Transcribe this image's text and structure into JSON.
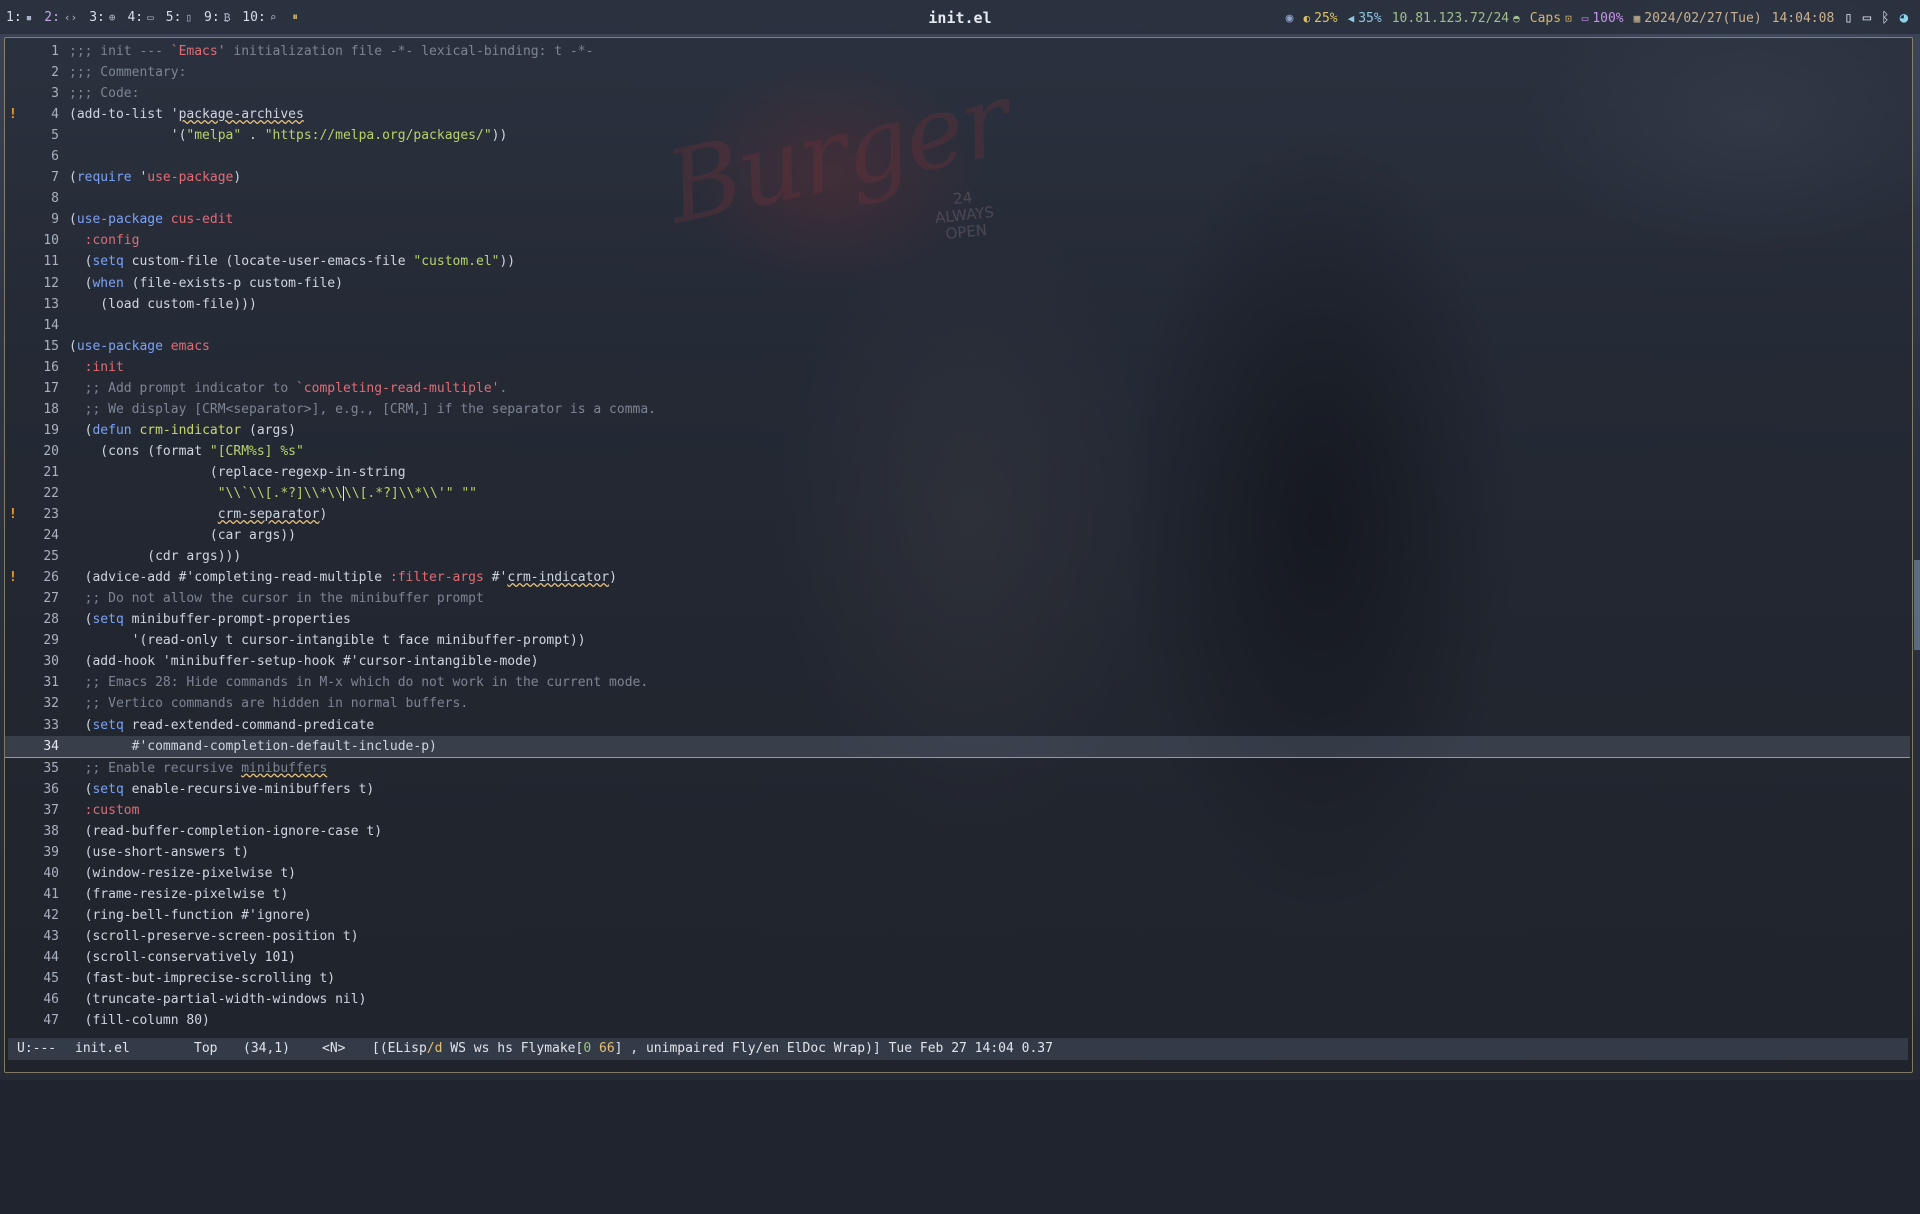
{
  "topbar": {
    "workspaces": [
      {
        "num": "1:",
        "icon": "terminal-icon",
        "glyph": "▪"
      },
      {
        "num": "2:",
        "icon": "code-icon",
        "glyph": "‹›"
      },
      {
        "num": "3:",
        "icon": "globe-icon",
        "glyph": "⊕"
      },
      {
        "num": "4:",
        "icon": "chat-icon",
        "glyph": "▭"
      },
      {
        "num": "5:",
        "icon": "file-icon",
        "glyph": "▯"
      },
      {
        "num": "9:",
        "icon": "bitcoin-icon",
        "glyph": "₿"
      },
      {
        "num": "10:",
        "icon": "search-icon",
        "glyph": "⌕"
      }
    ],
    "active_workspace_index": 1,
    "extra_glyph": "⏸",
    "window_title": "init.el",
    "status": {
      "brightness": "25%",
      "volume": "35%",
      "ip": "10.81.123.72/24",
      "caps": "Caps",
      "battery": "100%",
      "date": "2024/02/27(Tue)",
      "time": "14:04:08"
    }
  },
  "editor": {
    "current_line": 34,
    "lines": [
      {
        "n": "1",
        "fringe": "",
        "segs": [
          {
            "t": ";;; init --- ",
            "c": "c-com"
          },
          {
            "t": "`Emacs'",
            "c": "c-red"
          },
          {
            "t": " initialization file -*- lexical-binding: t -*-",
            "c": "c-com"
          }
        ]
      },
      {
        "n": "2",
        "fringe": "",
        "segs": [
          {
            "t": ";;; Commentary:",
            "c": "c-com"
          }
        ]
      },
      {
        "n": "3",
        "fringe": "",
        "segs": [
          {
            "t": ";;; Code:",
            "c": "c-com"
          }
        ]
      },
      {
        "n": "4",
        "fringe": "!",
        "segs": [
          {
            "t": "(add-to-list '",
            "c": ""
          },
          {
            "t": "package-archives",
            "c": "c-err"
          }
        ]
      },
      {
        "n": "5",
        "fringe": "",
        "segs": [
          {
            "t": "             '(",
            "c": ""
          },
          {
            "t": "\"melpa\"",
            "c": "c-str"
          },
          {
            "t": " . ",
            "c": ""
          },
          {
            "t": "\"https://melpa.org/packages/\"",
            "c": "c-str"
          },
          {
            "t": "))",
            "c": ""
          }
        ]
      },
      {
        "n": "6",
        "fringe": "",
        "segs": []
      },
      {
        "n": "7",
        "fringe": "",
        "segs": [
          {
            "t": "(",
            "c": ""
          },
          {
            "t": "require",
            "c": "c-kw"
          },
          {
            "t": " '",
            "c": ""
          },
          {
            "t": "use-package",
            "c": "c-const"
          },
          {
            "t": ")",
            "c": ""
          }
        ]
      },
      {
        "n": "8",
        "fringe": "",
        "segs": []
      },
      {
        "n": "9",
        "fringe": "",
        "segs": [
          {
            "t": "(",
            "c": ""
          },
          {
            "t": "use-package",
            "c": "c-kw"
          },
          {
            "t": " ",
            "c": ""
          },
          {
            "t": "cus-edit",
            "c": "c-const"
          }
        ]
      },
      {
        "n": "10",
        "fringe": "",
        "segs": [
          {
            "t": "  ",
            "c": ""
          },
          {
            "t": ":config",
            "c": "c-const"
          }
        ]
      },
      {
        "n": "11",
        "fringe": "",
        "segs": [
          {
            "t": "  (",
            "c": ""
          },
          {
            "t": "setq",
            "c": "c-kw"
          },
          {
            "t": " custom-file (locate-user-emacs-file ",
            "c": ""
          },
          {
            "t": "\"custom.el\"",
            "c": "c-str"
          },
          {
            "t": "))",
            "c": ""
          }
        ]
      },
      {
        "n": "12",
        "fringe": "",
        "segs": [
          {
            "t": "  (",
            "c": ""
          },
          {
            "t": "when",
            "c": "c-kw"
          },
          {
            "t": " (file-exists-p custom-file)",
            "c": ""
          }
        ]
      },
      {
        "n": "13",
        "fringe": "",
        "segs": [
          {
            "t": "    (load custom-file)))",
            "c": ""
          }
        ]
      },
      {
        "n": "14",
        "fringe": "",
        "segs": []
      },
      {
        "n": "15",
        "fringe": "",
        "segs": [
          {
            "t": "(",
            "c": ""
          },
          {
            "t": "use-package",
            "c": "c-kw"
          },
          {
            "t": " ",
            "c": ""
          },
          {
            "t": "emacs",
            "c": "c-const"
          }
        ]
      },
      {
        "n": "16",
        "fringe": "",
        "segs": [
          {
            "t": "  ",
            "c": ""
          },
          {
            "t": ":init",
            "c": "c-const"
          }
        ]
      },
      {
        "n": "17",
        "fringe": "",
        "segs": [
          {
            "t": "  ;; Add prompt indicator to ",
            "c": "c-com"
          },
          {
            "t": "`completing-read-multiple'",
            "c": "c-red"
          },
          {
            "t": ".",
            "c": "c-com"
          }
        ]
      },
      {
        "n": "18",
        "fringe": "",
        "segs": [
          {
            "t": "  ;; We display [CRM<separator>], e.g., [CRM,] if the separator is a comma.",
            "c": "c-com"
          }
        ]
      },
      {
        "n": "19",
        "fringe": "",
        "segs": [
          {
            "t": "  (",
            "c": ""
          },
          {
            "t": "defun",
            "c": "c-kw"
          },
          {
            "t": " ",
            "c": ""
          },
          {
            "t": "crm-indicator",
            "c": "c-fn"
          },
          {
            "t": " (args)",
            "c": ""
          }
        ]
      },
      {
        "n": "20",
        "fringe": "",
        "segs": [
          {
            "t": "    (cons (format ",
            "c": ""
          },
          {
            "t": "\"[CRM%s] %s\"",
            "c": "c-str"
          }
        ]
      },
      {
        "n": "21",
        "fringe": "",
        "segs": [
          {
            "t": "                  (replace-regexp-in-string",
            "c": ""
          }
        ]
      },
      {
        "n": "22",
        "fringe": "",
        "segs": [
          {
            "t": "                   ",
            "c": ""
          },
          {
            "t": "\"\\\\`\\\\[.*?]\\\\*\\\\",
            "c": "c-str"
          },
          {
            "t": "|",
            "c": "cursor"
          },
          {
            "t": "\\\\[.*?]\\\\*\\\\'\" \"\"",
            "c": "c-str"
          }
        ]
      },
      {
        "n": "23",
        "fringe": "!",
        "segs": [
          {
            "t": "                   ",
            "c": ""
          },
          {
            "t": "crm-separator",
            "c": "c-err"
          },
          {
            "t": ")",
            "c": ""
          }
        ]
      },
      {
        "n": "24",
        "fringe": "",
        "segs": [
          {
            "t": "                  (car args))",
            "c": ""
          }
        ]
      },
      {
        "n": "25",
        "fringe": "",
        "segs": [
          {
            "t": "          (cdr args)))",
            "c": ""
          }
        ]
      },
      {
        "n": "26",
        "fringe": "!",
        "segs": [
          {
            "t": "  (advice-add #'completing-read-multiple ",
            "c": ""
          },
          {
            "t": ":filter-args",
            "c": "c-const"
          },
          {
            "t": " #'",
            "c": ""
          },
          {
            "t": "crm-indicator",
            "c": "c-err"
          },
          {
            "t": ")",
            "c": ""
          }
        ]
      },
      {
        "n": "27",
        "fringe": "",
        "segs": [
          {
            "t": "  ;; Do not allow the cursor in the minibuffer prompt",
            "c": "c-com"
          }
        ]
      },
      {
        "n": "28",
        "fringe": "",
        "segs": [
          {
            "t": "  (",
            "c": ""
          },
          {
            "t": "setq",
            "c": "c-kw"
          },
          {
            "t": " minibuffer-prompt-properties",
            "c": ""
          }
        ]
      },
      {
        "n": "29",
        "fringe": "",
        "segs": [
          {
            "t": "        '(read-only t cursor-intangible t face minibuffer-prompt))",
            "c": ""
          }
        ]
      },
      {
        "n": "30",
        "fringe": "",
        "segs": [
          {
            "t": "  (add-hook 'minibuffer-setup-hook #'cursor-intangible-mode)",
            "c": ""
          }
        ]
      },
      {
        "n": "31",
        "fringe": "",
        "segs": [
          {
            "t": "  ;; Emacs 28: Hide commands in M-x which do not work in the current mode.",
            "c": "c-com"
          }
        ]
      },
      {
        "n": "32",
        "fringe": "",
        "segs": [
          {
            "t": "  ;; Vertico commands are hidden in normal buffers.",
            "c": "c-com"
          }
        ]
      },
      {
        "n": "33",
        "fringe": "",
        "segs": [
          {
            "t": "  (",
            "c": ""
          },
          {
            "t": "setq",
            "c": "c-kw"
          },
          {
            "t": " read-extended-command-predicate",
            "c": ""
          }
        ]
      },
      {
        "n": "34",
        "fringe": "",
        "segs": [
          {
            "t": "        #'command-completion-default-include-p)",
            "c": ""
          }
        ]
      },
      {
        "n": "35",
        "fringe": "",
        "segs": [
          {
            "t": "  ;; Enable recursive ",
            "c": "c-com"
          },
          {
            "t": "minibuffers",
            "c": "c-com c-err"
          }
        ]
      },
      {
        "n": "36",
        "fringe": "",
        "segs": [
          {
            "t": "  (",
            "c": ""
          },
          {
            "t": "setq",
            "c": "c-kw"
          },
          {
            "t": " enable-recursive-minibuffers t)",
            "c": ""
          }
        ]
      },
      {
        "n": "37",
        "fringe": "",
        "segs": [
          {
            "t": "  ",
            "c": ""
          },
          {
            "t": ":custom",
            "c": "c-const"
          }
        ]
      },
      {
        "n": "38",
        "fringe": "",
        "segs": [
          {
            "t": "  (read-buffer-completion-ignore-case t)",
            "c": ""
          }
        ]
      },
      {
        "n": "39",
        "fringe": "",
        "segs": [
          {
            "t": "  (use-short-answers t)",
            "c": ""
          }
        ]
      },
      {
        "n": "40",
        "fringe": "",
        "segs": [
          {
            "t": "  (window-resize-pixelwise t)",
            "c": ""
          }
        ]
      },
      {
        "n": "41",
        "fringe": "",
        "segs": [
          {
            "t": "  (frame-resize-pixelwise t)",
            "c": ""
          }
        ]
      },
      {
        "n": "42",
        "fringe": "",
        "segs": [
          {
            "t": "  (ring-bell-function #'ignore)",
            "c": ""
          }
        ]
      },
      {
        "n": "43",
        "fringe": "",
        "segs": [
          {
            "t": "  (scroll-preserve-screen-position t)",
            "c": ""
          }
        ]
      },
      {
        "n": "44",
        "fringe": "",
        "segs": [
          {
            "t": "  (scroll-conservatively 101)",
            "c": ""
          }
        ]
      },
      {
        "n": "45",
        "fringe": "",
        "segs": [
          {
            "t": "  (fast-but-imprecise-scrolling t)",
            "c": ""
          }
        ]
      },
      {
        "n": "46",
        "fringe": "",
        "segs": [
          {
            "t": "  (truncate-partial-width-windows nil)",
            "c": ""
          }
        ]
      },
      {
        "n": "47",
        "fringe": "",
        "segs": [
          {
            "t": "  (fill-column 80)",
            "c": ""
          }
        ]
      }
    ]
  },
  "modeline": {
    "state": "U:---",
    "buffer": "init.el",
    "position": "Top",
    "coords": "(34,1)",
    "evil_state": "<N>",
    "modes_prefix": "[(ELisp",
    "modes_sub": "/d",
    "modes_mid": " WS ws hs Flymake[",
    "fly_ok": "0",
    "fly_warn": "66",
    "modes_suffix": "] , unimpaired Fly/en ElDoc Wrap)] Tue Feb 27 14:04 0.37"
  },
  "colors": {
    "frame_border": "#cdc396",
    "keyword": "#7aa2f7",
    "string": "#b7d36b",
    "constant": "#e06c75",
    "comment": "#7d8593",
    "warning_fringe": "#f0a030"
  }
}
